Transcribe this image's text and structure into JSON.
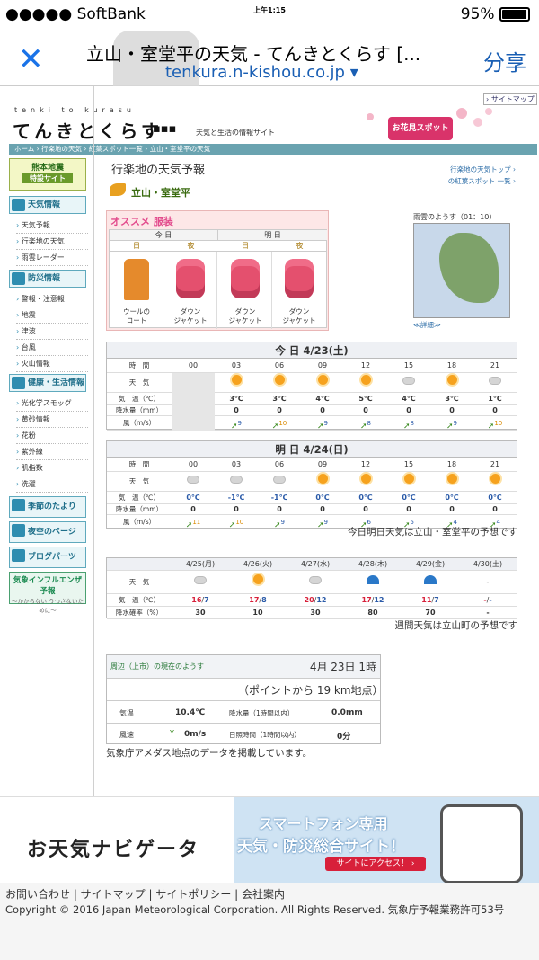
{
  "status": {
    "carrier": "●●●●● SoftBank",
    "time": "上午1:15",
    "battery": "95%"
  },
  "nav": {
    "close": "✕",
    "title": "立山・室堂平の天気 - てんきとくらす [...",
    "url": "tenkura.n-kishou.co.jp ▾",
    "share": "分享"
  },
  "header": {
    "sitemap": "› サイトマップ",
    "logo_sub": "tenki to kurasu",
    "logo": "てんきとくらす",
    "tagline": "天気と生活の情報サイト",
    "hana": "お花見スポット",
    "crumb": "ホーム › 行楽地の天気 › 紅葉スポット一覧 › 立山・室堂平の天気"
  },
  "sidebar": {
    "quake_1": "熊本地震",
    "quake_2": "特設サイト",
    "weather_head": "天気情報",
    "weather_items": [
      "天気予報",
      "行楽地の天気",
      "雨雲レーダー"
    ],
    "disaster_head": "防災情報",
    "disaster_items": [
      "警報・注意報",
      "地震",
      "津波",
      "台風",
      "火山情報"
    ],
    "health_head": "健康・生活情報",
    "health_items": [
      "光化学スモッグ",
      "黄砂情報",
      "花粉",
      "紫外線",
      "肌指数",
      "洗濯"
    ],
    "banners": [
      "季節のたより",
      "夜空のページ",
      "ブログパーツ"
    ],
    "flu_1": "気象インフルエンザ予報",
    "flu_2": "〜かからない うつさないために〜"
  },
  "main": {
    "title": "行楽地の天気予報",
    "location": "立山・室堂平",
    "link1": "行楽地の天気トップ ›",
    "link2": "の紅葉スポット 一覧 ›",
    "radar_title": "雨雲のようす（01：10）",
    "radar_link": "≪詳細≫"
  },
  "clothing": {
    "head": "オススメ 服装",
    "today": "今 日",
    "tomorrow": "明 日",
    "day": "日",
    "night": "夜",
    "items": [
      {
        "l1": "ウールの",
        "l2": "コート",
        "kind": "coat"
      },
      {
        "l1": "ダウン",
        "l2": "ジャケット",
        "kind": "down"
      },
      {
        "l1": "ダウン",
        "l2": "ジャケット",
        "kind": "down"
      },
      {
        "l1": "ダウン",
        "l2": "ジャケット",
        "kind": "down"
      }
    ]
  },
  "today": {
    "title": "今 日 4/23(土)",
    "labels": [
      "時　間",
      "天　気",
      "気　温（℃）",
      "降水量（mm）",
      "風（m/s）"
    ],
    "hours": [
      "00",
      "03",
      "06",
      "09",
      "12",
      "15",
      "18",
      "21"
    ],
    "weather": [
      "",
      "sun",
      "sun",
      "sun",
      "sun",
      "cloud",
      "sun",
      "cloud"
    ],
    "temp": [
      "",
      "3℃",
      "3℃",
      "4℃",
      "5℃",
      "4℃",
      "3℃",
      "1℃"
    ],
    "rain": [
      "",
      "0",
      "0",
      "0",
      "0",
      "0",
      "0",
      "0"
    ],
    "wind": [
      "",
      "9",
      "10",
      "9",
      "8",
      "8",
      "9",
      "10"
    ],
    "wind_color": [
      "",
      "n",
      "y",
      "n",
      "n",
      "n",
      "n",
      "y"
    ]
  },
  "tomorrow": {
    "title": "明 日 4/24(日)",
    "labels": [
      "時　間",
      "天　気",
      "気　温（℃）",
      "降水量（mm）",
      "風（m/s）"
    ],
    "hours": [
      "00",
      "03",
      "06",
      "09",
      "12",
      "15",
      "18",
      "21"
    ],
    "weather": [
      "cloud",
      "cloud",
      "cloud",
      "sun",
      "sun",
      "sun",
      "sun",
      "sun"
    ],
    "temp": [
      "0℃",
      "-1℃",
      "-1℃",
      "0℃",
      "0℃",
      "0℃",
      "0℃",
      "0℃"
    ],
    "rain": [
      "0",
      "0",
      "0",
      "0",
      "0",
      "0",
      "0",
      "0"
    ],
    "wind": [
      "11",
      "10",
      "9",
      "9",
      "6",
      "5",
      "4",
      "4"
    ],
    "wind_color": [
      "y",
      "y",
      "n",
      "n",
      "n",
      "n",
      "n",
      "n"
    ]
  },
  "note_today": "今日明日天気は立山・室堂平の予想です",
  "weekly": {
    "labels": [
      "天　気",
      "気　温（℃）",
      "降水確率（%）"
    ],
    "days": [
      "4/25(月)",
      "4/26(火)",
      "4/27(水)",
      "4/28(木)",
      "4/29(金)",
      "4/30(土)"
    ],
    "weather": [
      "cloud",
      "sun",
      "cloud",
      "rain",
      "rain",
      "-"
    ],
    "hi": [
      "16",
      "17",
      "20",
      "17",
      "11",
      "-"
    ],
    "lo": [
      "7",
      "8",
      "12",
      "12",
      "7",
      "-"
    ],
    "pop": [
      "30",
      "10",
      "30",
      "80",
      "70",
      "-"
    ]
  },
  "note_week": "週間天気は立山町の予想です",
  "amedas": {
    "head": "周辺（上市）の現在のようす",
    "date": "4月 23日 1時",
    "distance": "（ポイントから 19 km地点）",
    "temp_l": "気温",
    "temp_v": "10.4℃",
    "rain_l": "降水量（1時間以内）",
    "rain_v": "0.0mm",
    "wind_l": "風速",
    "wind_v": "0m/s",
    "sun_l": "日照時間（1時間以内）",
    "sun_v": "0分",
    "note": "気象庁アメダス地点のデータを掲載しています。"
  },
  "banner": {
    "logo": "お天気ナビゲータ",
    "line1": "スマートフォン専用",
    "line2": "天気・防災総合サイト！",
    "button": "サイトにアクセス！ ›"
  },
  "footer": {
    "links": "お問い合わせ | サイトマップ | サイトポリシー | 会社案内",
    "copyright": "Copyright © 2016 Japan Meteorological Corporation. All Rights Reserved. 気象庁予報業務許可53号"
  }
}
